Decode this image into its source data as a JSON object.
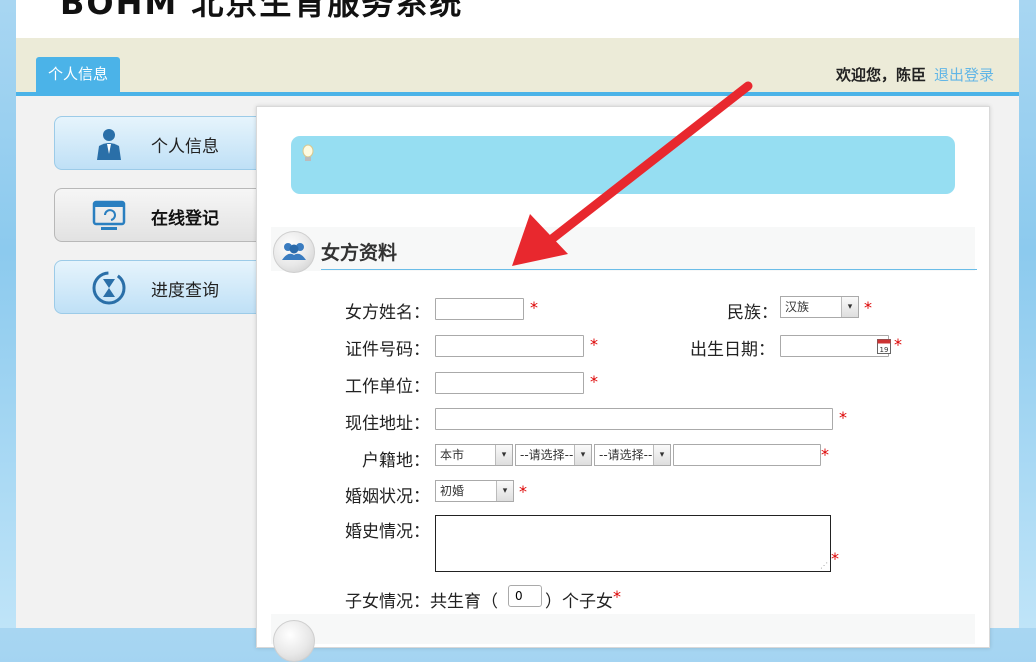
{
  "header": {
    "brand": "BOHM 北京生育服务系统",
    "tab_label": "个人信息",
    "welcome": "欢迎您，陈臣",
    "logout": "退出登录"
  },
  "sidebar": {
    "items": [
      {
        "label": "个人信息",
        "icon": "user-icon"
      },
      {
        "label": "在线登记",
        "icon": "monitor-icon"
      },
      {
        "label": "进度查询",
        "icon": "hourglass-icon"
      }
    ],
    "active_index": 1
  },
  "section": {
    "title": "女方资料",
    "icon": "users-icon"
  },
  "form": {
    "name_label": "女方姓名：",
    "nation_label": "民族：",
    "nation_value": "汉族",
    "id_label": "证件号码：",
    "birth_label": "出生日期：",
    "birth_icon": "calendar-icon",
    "work_label": "工作单位：",
    "address_label": "现住地址：",
    "hukou_label": "户籍地：",
    "hukou_select1": "本市",
    "hukou_select2": "--请选择--",
    "hukou_select3": "--请选择--",
    "marital_label": "婚姻状况：",
    "marital_value": "初婚",
    "history_label": "婚史情况：",
    "children_label": "子女情况：共生育（",
    "children_count": "0",
    "children_suffix": "）个子女",
    "required_mark": "*"
  },
  "colors": {
    "accent": "#4bb3e8",
    "notice_bg": "#96def2",
    "required": "#dd0000",
    "annotation_arrow": "#e8282e"
  }
}
